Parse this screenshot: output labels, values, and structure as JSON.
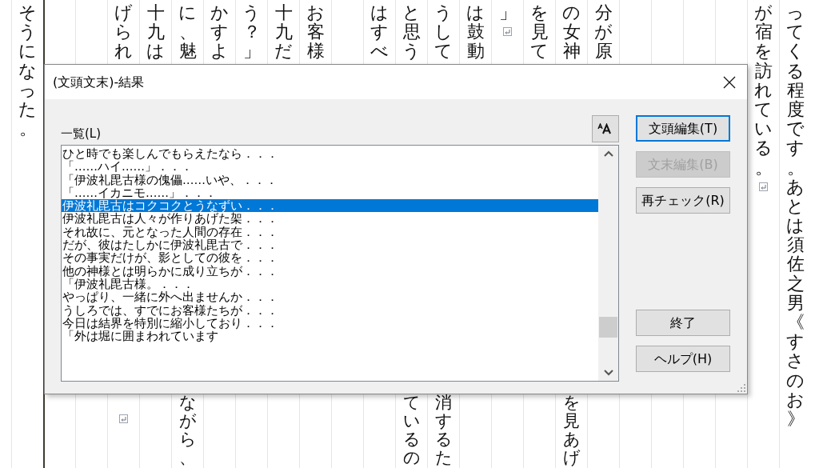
{
  "document": {
    "columns": [
      {
        "top": [
          {
            "kind": "text",
            "text": "そうになった。"
          }
        ]
      },
      {},
      {},
      {
        "top": [
          {
            "kind": "text",
            "text": "げられ"
          }
        ],
        "bottom": [
          {
            "kind": "return_mark"
          }
        ]
      },
      {
        "top": [
          {
            "kind": "text",
            "text": "十九は"
          }
        ]
      },
      {
        "top": [
          {
            "kind": "text",
            "text": "に、魅"
          }
        ],
        "bottom": [
          {
            "kind": "text",
            "text": "ながら、"
          }
        ]
      },
      {
        "top": [
          {
            "kind": "text",
            "text": "かすよ"
          }
        ]
      },
      {
        "top": [
          {
            "kind": "text",
            "text": "う？」"
          }
        ]
      },
      {
        "top": [
          {
            "kind": "text",
            "text": "十九だ"
          }
        ]
      },
      {
        "top": [
          {
            "kind": "text",
            "text": "お客様"
          }
        ]
      },
      {},
      {
        "top": [
          {
            "kind": "text",
            "text": "はすべ"
          }
        ]
      },
      {
        "top": [
          {
            "kind": "text",
            "text": "と思う"
          }
        ],
        "bottom": [
          {
            "kind": "text",
            "text": "ているの"
          }
        ]
      },
      {
        "top": [
          {
            "kind": "text",
            "text": "うして"
          }
        ],
        "bottom": [
          {
            "kind": "text",
            "text": "消するた"
          }
        ]
      },
      {
        "top": [
          {
            "kind": "text",
            "text": "は鼓動"
          }
        ]
      },
      {
        "top": [
          {
            "kind": "text",
            "text": "」"
          },
          {
            "kind": "return_mark"
          }
        ]
      },
      {
        "top": [
          {
            "kind": "text",
            "text": "を見て"
          }
        ]
      },
      {
        "top": [
          {
            "kind": "text",
            "text": "の女神"
          }
        ],
        "bottom": [
          {
            "kind": "text",
            "text": "を見あげ"
          }
        ]
      },
      {
        "top": [
          {
            "kind": "text",
            "text": "分が原"
          }
        ]
      },
      {},
      {},
      {},
      {},
      {
        "top": [
          {
            "kind": "text",
            "text": "が宿を訪れている。"
          },
          {
            "kind": "return_mark"
          }
        ]
      },
      {
        "top": [
          {
            "kind": "text",
            "text": "ってくる程度です。あとは須佐之男《すさのお》"
          }
        ]
      }
    ]
  },
  "dialog": {
    "title": "(文頭文末)-結果",
    "list_label": "一覧(L)",
    "items": [
      {
        "text": "ひと時でも楽しんでもらえたなら．．．",
        "selected": false
      },
      {
        "text": "「……ハイ……」．．．",
        "selected": false
      },
      {
        "text": "「伊波礼毘古様の傀儡……いや、．．．",
        "selected": false
      },
      {
        "text": "「……イカニモ……」．．．",
        "selected": false
      },
      {
        "text": "伊波礼毘古はコクコクとうなずい．．．",
        "selected": true
      },
      {
        "text": "伊波礼毘古は人々が作りあげた架．．．",
        "selected": false
      },
      {
        "text": "それ故に、元となった人間の存在．．．",
        "selected": false
      },
      {
        "text": "だが、彼はたしかに伊波礼毘古で．．．",
        "selected": false
      },
      {
        "text": "その事実だけが、影としての彼を．．．",
        "selected": false
      },
      {
        "text": "他の神様とは明らかに成り立ちが．．．",
        "selected": false
      },
      {
        "text": "「伊波礼毘古様。．．．",
        "selected": false
      },
      {
        "text": "やっぱり、一緒に外へ出ませんか．．．",
        "selected": false
      },
      {
        "text": "うしろでは、すでにお客様たちが．．．",
        "selected": false
      },
      {
        "text": "今日は結界を特別に縮小しており．．．",
        "selected": false
      },
      {
        "text": "「外は堀に囲まわれています",
        "selected": false
      }
    ],
    "edit_buttons": [
      {
        "label": "文頭編集(T)",
        "focused": true,
        "disabled": false
      },
      {
        "label": "文末編集(B)",
        "focused": false,
        "disabled": true
      },
      {
        "label": "再チェック(R)",
        "focused": false,
        "disabled": false
      }
    ],
    "exit_buttons": [
      {
        "label": "終了",
        "focused": false,
        "disabled": false
      },
      {
        "label": "ヘルプ(H)",
        "focused": false,
        "disabled": false
      }
    ]
  }
}
